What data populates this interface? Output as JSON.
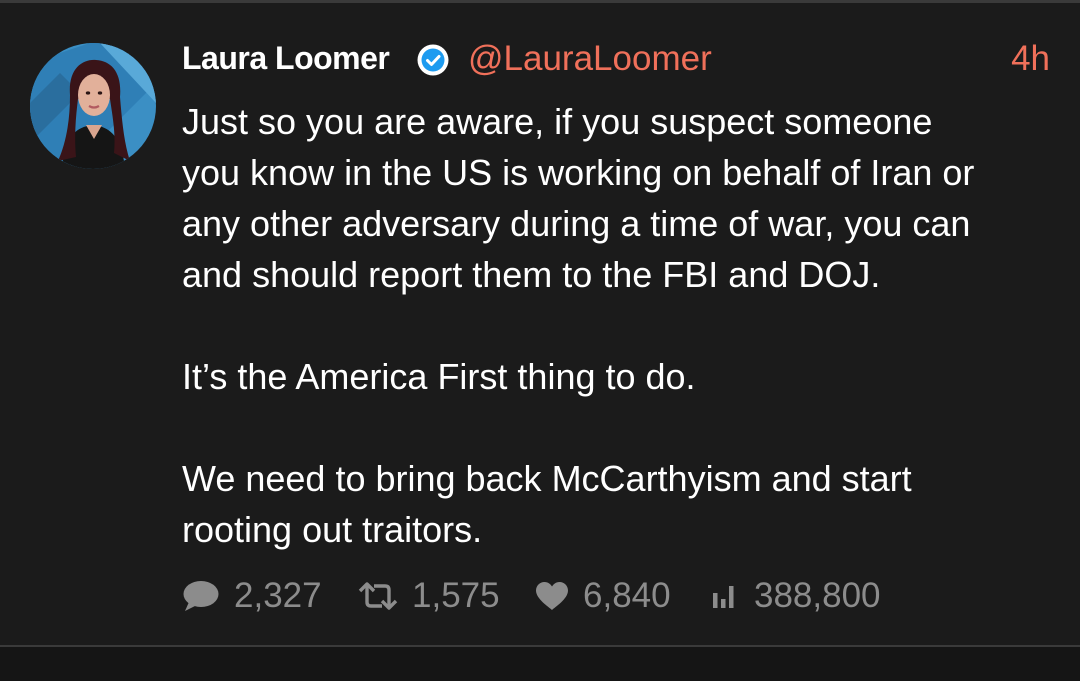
{
  "colors": {
    "background": "#1b1b1b",
    "accent": "#f0705a",
    "text": "#ffffff",
    "muted": "#8c8c8c",
    "verified": "#1d9bf0"
  },
  "tweet": {
    "author": {
      "display_name": "Laura Loomer",
      "handle": "@LauraLoomer",
      "verified": true,
      "avatar_icon": "avatar"
    },
    "timestamp": "4h",
    "paragraphs": [
      {
        "lines": [
          "Just so you are aware, if you suspect someone",
          "you know in the US is working on behalf of Iran or",
          "any other adversary during a time of war, you can",
          "and should report them to the FBI and DOJ."
        ]
      },
      {
        "lines": [
          "It’s the America First thing to do."
        ]
      },
      {
        "lines": [
          "We need to bring back McCarthyism and start",
          "rooting out traitors."
        ]
      }
    ],
    "stats": {
      "replies": "2,327",
      "retweets": "1,575",
      "likes": "6,840",
      "views": "388,800"
    },
    "stat_icons": {
      "replies": "reply-icon",
      "retweets": "retweet-icon",
      "likes": "heart-icon",
      "views": "views-icon"
    }
  }
}
